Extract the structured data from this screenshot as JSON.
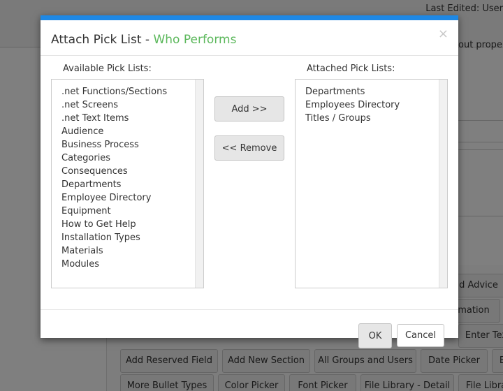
{
  "background": {
    "last_edited": "Last Edited: User",
    "side_text": "out proper",
    "buttons": [
      "d Advice",
      "mation",
      "Enter Tex",
      "Add Reserved Field",
      "Add New Section",
      "All Groups and Users",
      "Date Picker",
      "E",
      "More Bullet Types",
      "Color Picker",
      "Font Picker",
      "File Library - Detail",
      "File Libra"
    ]
  },
  "modal": {
    "title": "Attach Pick List - ",
    "title_accent": "Who Performs",
    "close_label": "×",
    "available_label": "Available Pick Lists:",
    "attached_label": "Attached Pick Lists:",
    "available_items": [
      ".net Functions/Sections",
      ".net Screens",
      ".net Text Items",
      "Audience",
      "Business Process",
      "Categories",
      "Consequences",
      "Departments",
      "Employee Directory",
      "Equipment",
      "How to Get Help",
      "Installation Types",
      "Materials",
      "Modules"
    ],
    "attached_items": [
      "Departments",
      "Employees Directory",
      "Titles / Groups"
    ],
    "add_label": "Add >>",
    "remove_label": "<< Remove",
    "ok_label": "OK",
    "cancel_label": "Cancel"
  },
  "colors": {
    "accent_green": "#5cb85c",
    "header_blue": "#1e88e5"
  }
}
